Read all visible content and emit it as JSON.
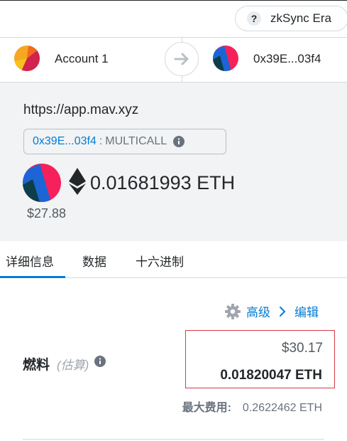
{
  "network": {
    "name": "zkSync Era",
    "icon": "question-icon"
  },
  "from_account": {
    "name": "Account 1"
  },
  "to_account": {
    "address": "0x39E...03f4"
  },
  "origin": "https://app.mav.xyz",
  "method": {
    "address": "0x39E...03f4",
    "separator": ":",
    "name": "MULTICALL"
  },
  "value": {
    "amount": "0.01681993 ETH",
    "fiat": "$27.88"
  },
  "tabs": [
    {
      "label": "详细信息",
      "active": true
    },
    {
      "label": "数据",
      "active": false
    },
    {
      "label": "十六进制",
      "active": false
    }
  ],
  "advanced": {
    "label": "高级",
    "edit_label": "编辑"
  },
  "gas": {
    "label": "燃料",
    "sub_label": "(估算)",
    "fiat": "$30.17",
    "eth": "0.01820047 ETH",
    "max_fee_label": "最大费用:",
    "max_fee_value": "0.2622462 ETH"
  },
  "colors": {
    "accent": "#037dd6",
    "error_border": "#d73a49",
    "summary_bg": "#f2f3f4"
  }
}
